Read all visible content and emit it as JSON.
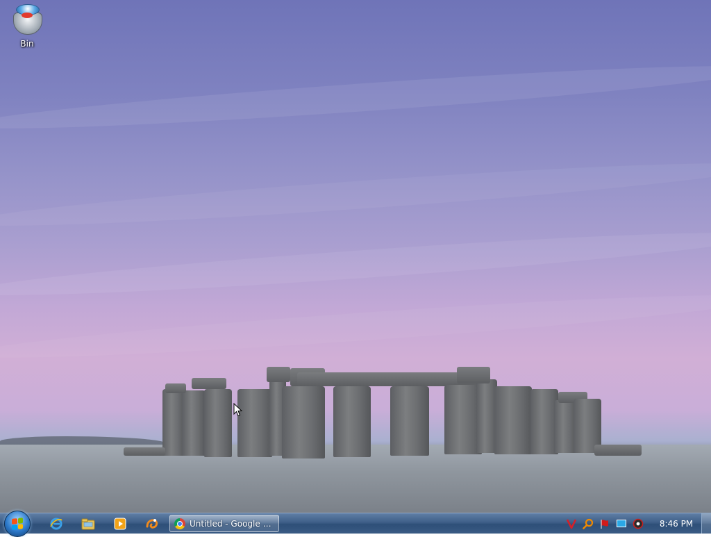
{
  "desktop": {
    "icons": [
      {
        "label": "Bin"
      }
    ]
  },
  "taskbar": {
    "start_icon": "windows-orb-icon",
    "pinned": [
      {
        "icon": "internet-explorer-icon"
      },
      {
        "icon": "file-explorer-icon"
      },
      {
        "icon": "media-player-icon"
      },
      {
        "icon": "uc-browser-icon"
      }
    ],
    "open_windows": [
      {
        "icon": "chrome-icon",
        "label": "Untitled - Google Ch..."
      }
    ],
    "tray": [
      {
        "icon": "vivaldi-icon",
        "color": "#d4202a"
      },
      {
        "icon": "search-magnifier-icon",
        "color": "#f08a00"
      },
      {
        "icon": "flag-icon",
        "color": "#d21b1b"
      },
      {
        "icon": "display-icon",
        "color": "#2aa8e6"
      },
      {
        "icon": "volume-icon",
        "color": "#c82020"
      }
    ],
    "clock": "8:46 PM"
  }
}
